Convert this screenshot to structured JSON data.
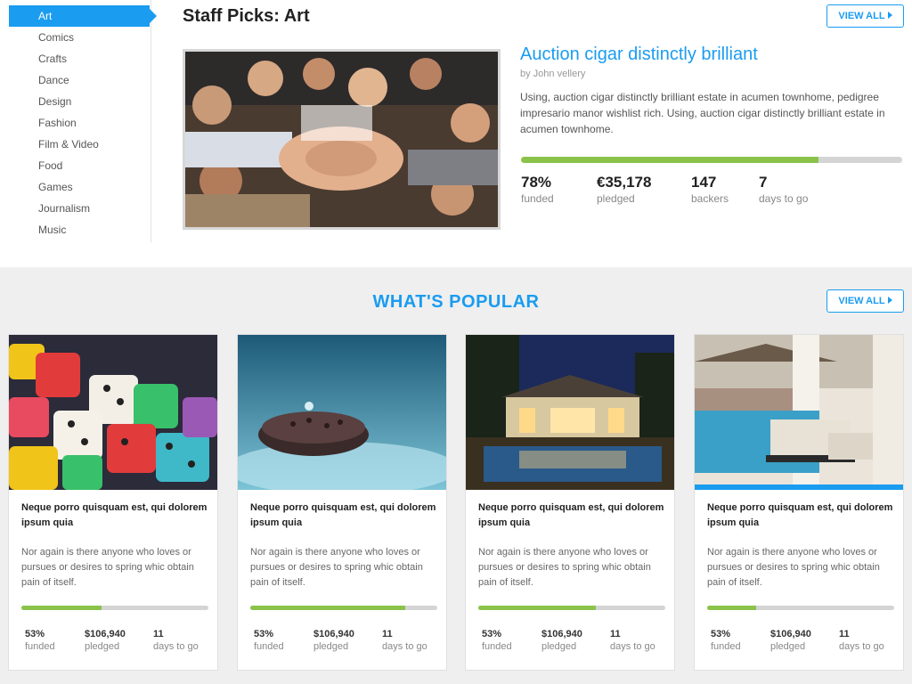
{
  "sidebar": {
    "categories": [
      "Art",
      "Comics",
      "Crafts",
      "Dance",
      "Design",
      "Fashion",
      "Film & Video",
      "Food",
      "Games",
      "Journalism",
      "Music"
    ],
    "active": "Art"
  },
  "staff_picks": {
    "title": "Staff Picks: Art",
    "view_all": "VIEW ALL",
    "feature": {
      "title": "Auction cigar distinctly brilliant",
      "author": "by John vellery",
      "description": "Using, auction cigar distinctly brilliant estate in acumen townhome, pedigree impresario manor wishlist rich. Using, auction cigar distinctly brilliant estate in acumen townhome.",
      "progress_percent": 78,
      "stats": [
        {
          "value": "78%",
          "label": "funded"
        },
        {
          "value": "€35,178",
          "label": "pledged"
        },
        {
          "value": "147",
          "label": "backers"
        },
        {
          "value": "7",
          "label": "days to go"
        }
      ]
    }
  },
  "popular": {
    "title": "WHAT'S POPULAR",
    "view_all": "VIEW ALL",
    "cards": [
      {
        "image": "dice",
        "title": "Neque porro quisquam est, qui dolorem ipsum quia",
        "description": "Nor again is there anyone who loves or pursues or desires to spring whic obtain pain of itself.",
        "progress_percent": 43,
        "stats": [
          {
            "value": "53%",
            "label": "funded"
          },
          {
            "value": "$106,940",
            "label": "pledged"
          },
          {
            "value": "11",
            "label": "days to go"
          }
        ]
      },
      {
        "image": "stone-on-water",
        "title": "Neque porro quisquam est, qui dolorem ipsum quia",
        "description": "Nor again is there anyone who loves or pursues or desires to spring whic obtain pain of itself.",
        "progress_percent": 83,
        "stats": [
          {
            "value": "53%",
            "label": "funded"
          },
          {
            "value": "$106,940",
            "label": "pledged"
          },
          {
            "value": "11",
            "label": "days to go"
          }
        ]
      },
      {
        "image": "house-pool-night",
        "title": "Neque porro quisquam est, qui dolorem ipsum quia",
        "description": "Nor again is there anyone who loves or pursues or desires to spring whic obtain pain of itself.",
        "progress_percent": 63,
        "stats": [
          {
            "value": "53%",
            "label": "funded"
          },
          {
            "value": "$106,940",
            "label": "pledged"
          },
          {
            "value": "11",
            "label": "days to go"
          }
        ]
      },
      {
        "image": "poolside-lounge",
        "title": "Neque porro quisquam est, qui dolorem ipsum quia",
        "description": "Nor again is there anyone who loves or pursues or desires to spring whic obtain pain of itself.",
        "progress_percent": 26,
        "stats": [
          {
            "value": "53%",
            "label": "funded"
          },
          {
            "value": "$106,940",
            "label": "pledged"
          },
          {
            "value": "11",
            "label": "days to go"
          }
        ]
      }
    ]
  },
  "colors": {
    "accent": "#1a9cf0",
    "progress": "#8bc34a",
    "track": "#d4d4d4"
  }
}
